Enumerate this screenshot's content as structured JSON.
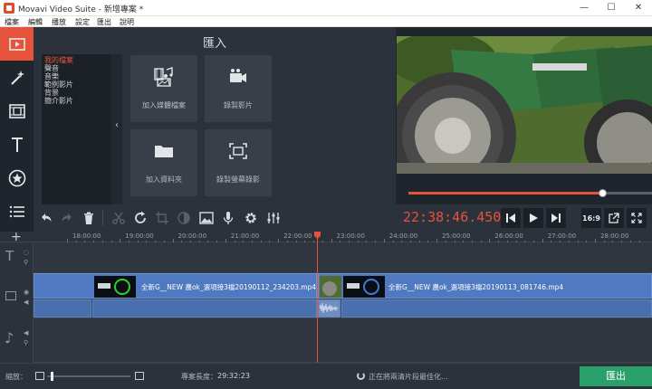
{
  "window": {
    "title": "Movavi Video Suite - 新增專案 *",
    "minimize": "—",
    "maximize": "☐",
    "close": "✕"
  },
  "menu": {
    "items": [
      "檔案",
      "編輯",
      "播放",
      "設定",
      "匯出",
      "說明"
    ]
  },
  "sidebar": {
    "items": [
      {
        "name": "import",
        "icon": "film-import-icon",
        "active": true
      },
      {
        "name": "filters",
        "icon": "magic-wand-icon",
        "active": false
      },
      {
        "name": "transitions",
        "icon": "transitions-icon",
        "active": false
      },
      {
        "name": "titles",
        "icon": "text-icon",
        "active": false
      },
      {
        "name": "stickers",
        "icon": "star-badge-icon",
        "active": false
      },
      {
        "name": "more",
        "icon": "list-icon",
        "active": false
      }
    ]
  },
  "import_panel": {
    "title": "匯入",
    "categories": [
      "我的檔案",
      "聲音",
      "音樂",
      "範例影片",
      "背景",
      "簡介影片"
    ],
    "selected_category": "我的檔案",
    "collapse_glyph": "‹",
    "tiles": [
      {
        "label": "加入媒體檔案",
        "icon": "media-files-icon"
      },
      {
        "label": "錄製影片",
        "icon": "camera-icon"
      },
      {
        "label": "加入資料夾",
        "icon": "folder-icon"
      },
      {
        "label": "錄製螢幕錄影",
        "icon": "screen-capture-icon"
      }
    ]
  },
  "preview": {
    "progress_fraction": 0.801
  },
  "playback": {
    "time": "22:38:46.450",
    "aspect_label": "16:9"
  },
  "timeline": {
    "ticks": [
      "18:00:00",
      "19:00:00",
      "20:00:00",
      "21:00:00",
      "22:00:00",
      "23:00:00",
      "24:00:00",
      "25:00:00",
      "26:00:00",
      "27:00:00",
      "28:00:00"
    ],
    "clips": [
      {
        "name": "全新G__NEW 農ok_選項接3檔20190112_234203.mp4"
      },
      {
        "name": "全新G__NEW 農ok_選項接3檔20190113_081746.mp4"
      }
    ]
  },
  "status": {
    "zoom_label": "縮放：",
    "duration_label": "專案長度：",
    "duration_value": "29:32:23",
    "status_text": "正在將兩清片段最佳化...",
    "export_label": "匯出"
  },
  "colors": {
    "accent": "#e5533b",
    "export_green": "#2aa16b",
    "clip_blue": "#4f79c0"
  }
}
